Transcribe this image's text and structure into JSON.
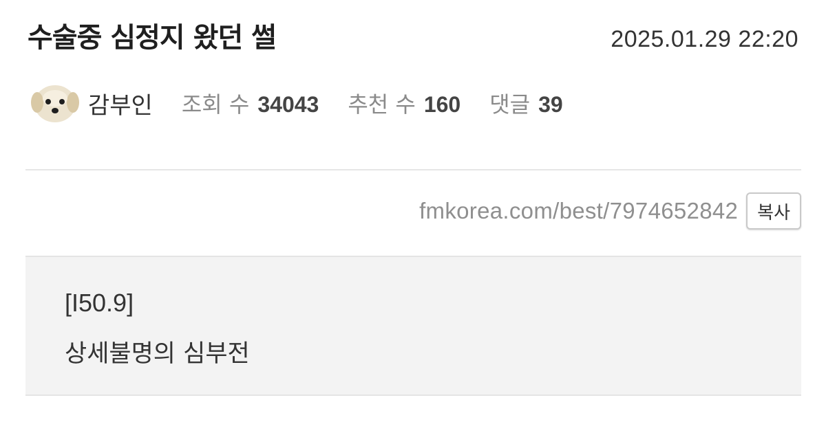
{
  "post": {
    "title": "수술중 심정지 왔던 썰",
    "date": "2025.01.29 22:20"
  },
  "meta": {
    "author": "감부인",
    "avatar_icon": "puppy-avatar-icon",
    "views_label": "조회 수",
    "views_value": "34043",
    "recommend_label": "추천 수",
    "recommend_value": "160",
    "comments_label": "댓글",
    "comments_value": "39"
  },
  "link": {
    "url": "fmkorea.com/best/7974652842",
    "copy_label": "복사"
  },
  "content": {
    "code": "[I50.9]",
    "description": "상세불명의 심부전"
  },
  "colors": {
    "content_background": "#f3f3f3",
    "divider": "#e6e6e6",
    "muted_text": "#8a8a8a"
  }
}
